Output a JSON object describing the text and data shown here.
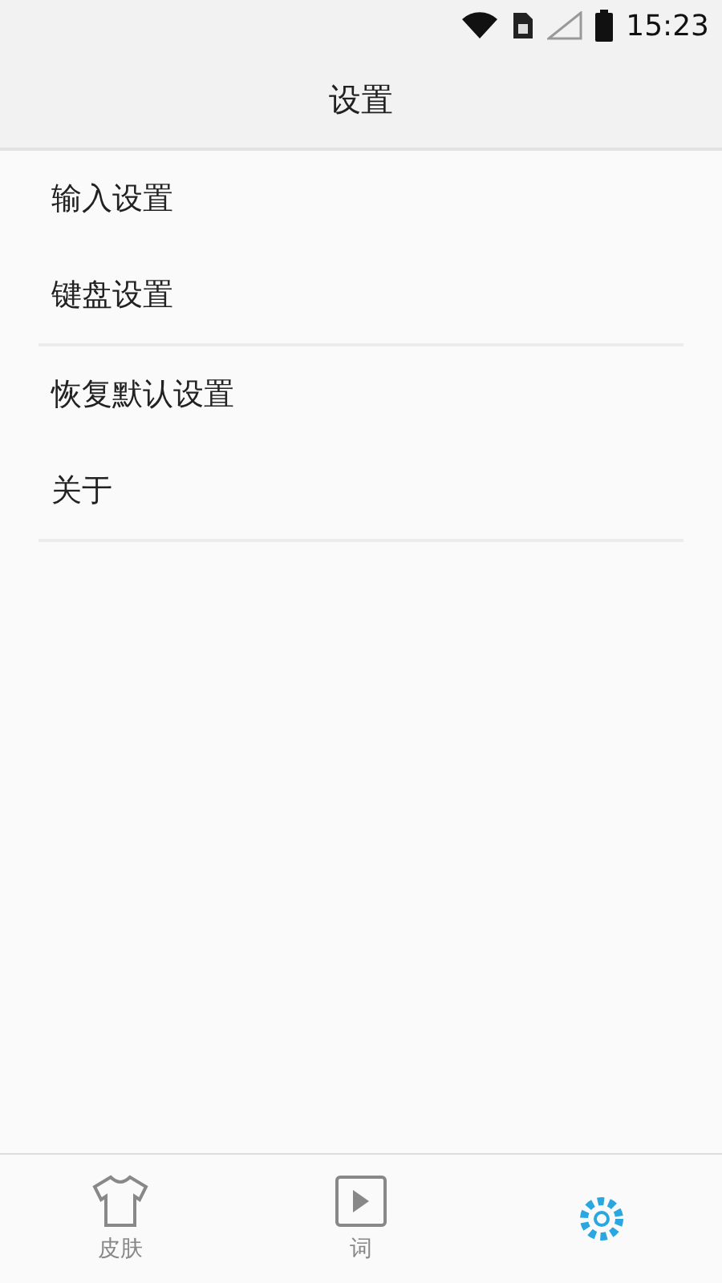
{
  "status_bar": {
    "time": "15:23"
  },
  "header": {
    "title": "设置"
  },
  "sections": [
    {
      "items": [
        {
          "label": "输入设置"
        },
        {
          "label": "键盘设置"
        }
      ]
    },
    {
      "items": [
        {
          "label": "恢复默认设置"
        },
        {
          "label": "关于"
        }
      ]
    }
  ],
  "tab_bar": [
    {
      "kind": "shirt",
      "label": "皮肤",
      "selected": false
    },
    {
      "kind": "dictionary",
      "label": "词",
      "selected": false
    },
    {
      "kind": "gear",
      "selected": true
    }
  ]
}
